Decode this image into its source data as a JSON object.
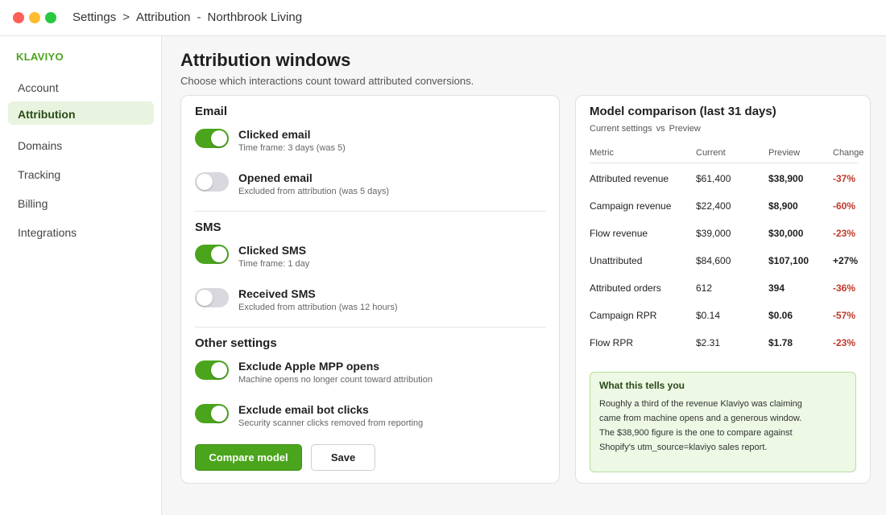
{
  "window": {
    "breadcrumb": [
      "Settings",
      "Attribution"
    ],
    "breadcrumb_sep": ">",
    "title_sep": "-",
    "account_name": "Northbrook Living"
  },
  "sidebar": {
    "brand": "KLAVIYO",
    "items": [
      {
        "label": "Account",
        "active": false
      },
      {
        "label": "Attribution",
        "active": true
      },
      {
        "label": "Domains",
        "active": false
      },
      {
        "label": "Tracking",
        "active": false
      },
      {
        "label": "Billing",
        "active": false
      },
      {
        "label": "Integrations",
        "active": false
      }
    ]
  },
  "page": {
    "title": "Attribution windows",
    "subtitle": "Choose which interactions count toward attributed conversions."
  },
  "settings": {
    "email": {
      "heading": "Email",
      "options": [
        {
          "title": "Clicked email",
          "desc": "Time frame:  3 days   (was 5)",
          "enabled": true
        },
        {
          "title": "Opened email",
          "desc": "Excluded from attribution  (was 5 days)",
          "enabled": false
        }
      ]
    },
    "sms": {
      "heading": "SMS",
      "options": [
        {
          "title": "Clicked SMS",
          "desc": "Time frame:  1 day",
          "enabled": true
        },
        {
          "title": "Received SMS",
          "desc": "Excluded from attribution  (was 12 hours)",
          "enabled": false
        }
      ]
    },
    "other": {
      "heading": "Other settings",
      "options": [
        {
          "title": "Exclude Apple MPP opens",
          "desc": "Machine opens no longer count toward attribution",
          "enabled": true
        },
        {
          "title": "Exclude email bot clicks",
          "desc": "Security scanner clicks removed from reporting",
          "enabled": true
        }
      ]
    },
    "buttons": {
      "compare": "Compare model",
      "save": "Save"
    }
  },
  "comparison": {
    "title": "Model comparison  (last 31 days)",
    "sub_left": "Current settings",
    "sub_vs": "vs",
    "sub_right": "Preview",
    "columns": [
      "Metric",
      "Current",
      "Preview",
      "Change"
    ],
    "rows": [
      {
        "metric": "Attributed revenue",
        "current": "$61,400",
        "preview": "$38,900",
        "change": "-37%"
      },
      {
        "metric": "Campaign revenue",
        "current": "$22,400",
        "preview": "$8,900",
        "change": "-60%"
      },
      {
        "metric": "Flow revenue",
        "current": "$39,000",
        "preview": "$30,000",
        "change": "-23%"
      },
      {
        "metric": "Unattributed",
        "current": "$84,600",
        "preview": "$107,100",
        "change": "+27%"
      },
      {
        "metric": "Attributed orders",
        "current": "612",
        "preview": "394",
        "change": "-36%"
      },
      {
        "metric": "Campaign RPR",
        "current": "$0.14",
        "preview": "$0.06",
        "change": "-57%"
      },
      {
        "metric": "Flow RPR",
        "current": "$2.31",
        "preview": "$1.78",
        "change": "-23%"
      }
    ],
    "note": {
      "title": "What this tells you",
      "lines": [
        "Roughly a third of the revenue Klaviyo was claiming",
        "came from machine opens and a generous window.",
        "The $38,900 figure is the one to compare against",
        "Shopify's utm_source=klaviyo sales report."
      ]
    }
  },
  "colors": {
    "accent": "#4aa51c",
    "negative": "#c0392b",
    "toggle_off": "#d8d8de"
  }
}
